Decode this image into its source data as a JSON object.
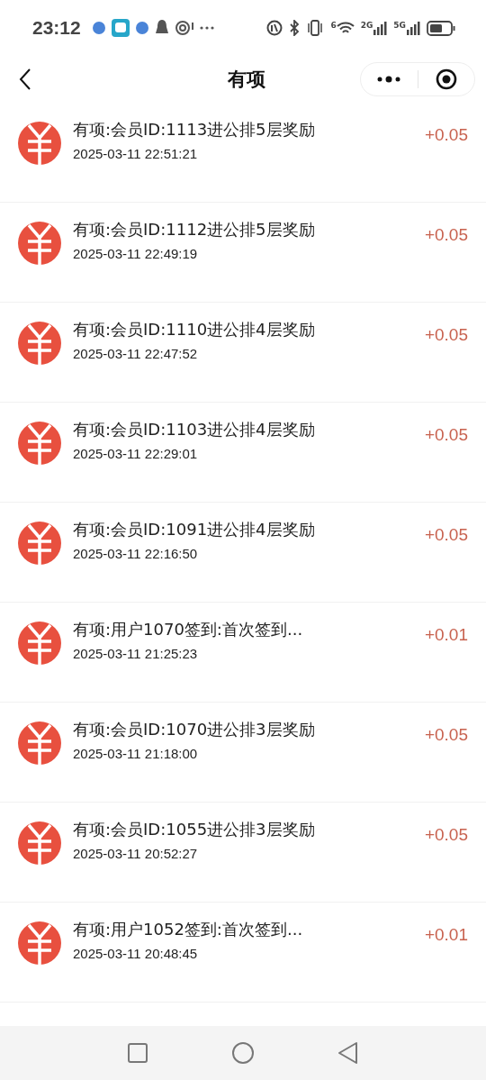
{
  "status_bar": {
    "time": "23:12",
    "wifi_label": "6",
    "signal_labels": [
      "2G",
      "5G"
    ]
  },
  "header": {
    "title": "有项"
  },
  "records": [
    {
      "title": "有项:会员ID:1113进公排5层奖励",
      "time": "2025-03-11 22:51:21",
      "amount": "+0.05"
    },
    {
      "title": "有项:会员ID:1112进公排5层奖励",
      "time": "2025-03-11 22:49:19",
      "amount": "+0.05"
    },
    {
      "title": "有项:会员ID:1110进公排4层奖励",
      "time": "2025-03-11 22:47:52",
      "amount": "+0.05"
    },
    {
      "title": "有项:会员ID:1103进公排4层奖励",
      "time": "2025-03-11 22:29:01",
      "amount": "+0.05"
    },
    {
      "title": "有项:会员ID:1091进公排4层奖励",
      "time": "2025-03-11 22:16:50",
      "amount": "+0.05"
    },
    {
      "title": "有项:用户1070签到:首次签到...",
      "time": "2025-03-11 21:25:23",
      "amount": "+0.01"
    },
    {
      "title": "有项:会员ID:1070进公排3层奖励",
      "time": "2025-03-11 21:18:00",
      "amount": "+0.05"
    },
    {
      "title": "有项:会员ID:1055进公排3层奖励",
      "time": "2025-03-11 20:52:27",
      "amount": "+0.05"
    },
    {
      "title": "有项:用户1052签到:首次签到...",
      "time": "2025-03-11 20:48:45",
      "amount": "+0.01"
    }
  ]
}
